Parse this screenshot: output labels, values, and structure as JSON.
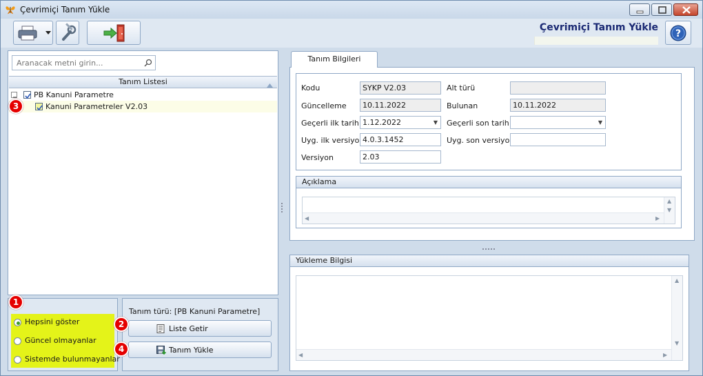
{
  "window": {
    "title": "Çevrimiçi Tanım Yükle",
    "accent": "#1b2a74"
  },
  "toolbar": {
    "title": "Çevrimiçi Tanım Yükle",
    "icons": [
      "printer-icon",
      "wrench-icon",
      "exit-door-icon",
      "help-icon"
    ]
  },
  "search": {
    "placeholder": "Aranacak metni girin..."
  },
  "tree": {
    "header": "Tanım Listesi",
    "items": [
      {
        "label": "PB Kanuni Parametre",
        "checked": true,
        "expanded": true
      },
      {
        "label": "Kanuni Parametreler V2.03",
        "checked": true
      }
    ]
  },
  "badges": [
    "1",
    "2",
    "3",
    "4"
  ],
  "filter": {
    "options": [
      {
        "label": "Hepsini göster",
        "selected": true
      },
      {
        "label": "Güncel olmayanlar",
        "selected": false
      },
      {
        "label": "Sistemde bulunmayanlar",
        "selected": false
      }
    ],
    "highlight_color": "#e4f319"
  },
  "actions": {
    "type_label": "Tanım türü: [PB Kanuni Parametre]",
    "list_button": "Liste Getir",
    "load_button": "Tanım Yükle"
  },
  "tab": {
    "label": "Tanım Bilgileri"
  },
  "fields": {
    "kodu_label": "Kodu",
    "kodu_value": "SYKP V2.03",
    "alt_turu_label": "Alt türü",
    "alt_turu_value": "",
    "guncelleme_label": "Güncelleme",
    "guncelleme_value": "10.11.2022",
    "bulunan_label": "Bulunan",
    "bulunan_value": "10.11.2022",
    "gecerli_ilk_label": "Geçerli ilk tarih",
    "gecerli_ilk_value": "1.12.2022",
    "gecerli_son_label": "Geçerli son tarih",
    "gecerli_son_value": "",
    "uyg_ilk_label": "Uyg. ilk versiyon",
    "uyg_ilk_value": "4.0.3.1452",
    "uyg_son_label": "Uyg. son versiyon",
    "uyg_son_value": "",
    "versiyon_label": "Versiyon",
    "versiyon_value": "2.03"
  },
  "aciklama": {
    "header": "Açıklama",
    "value": ""
  },
  "yukleme": {
    "header": "Yükleme Bilgisi",
    "value": ""
  }
}
